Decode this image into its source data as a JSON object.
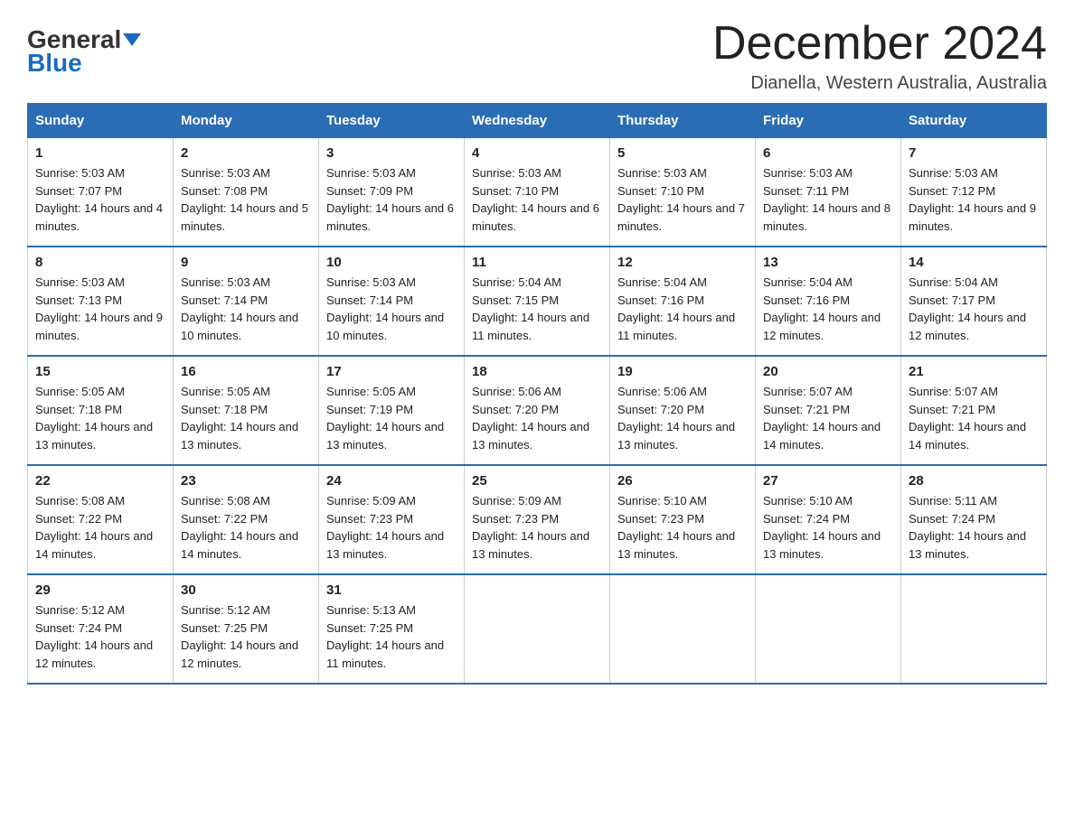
{
  "logo": {
    "general": "General",
    "blue": "Blue"
  },
  "header": {
    "month": "December 2024",
    "location": "Dianella, Western Australia, Australia"
  },
  "weekdays": [
    "Sunday",
    "Monday",
    "Tuesday",
    "Wednesday",
    "Thursday",
    "Friday",
    "Saturday"
  ],
  "weeks": [
    [
      {
        "day": "1",
        "sunrise": "5:03 AM",
        "sunset": "7:07 PM",
        "daylight": "14 hours and 4 minutes."
      },
      {
        "day": "2",
        "sunrise": "5:03 AM",
        "sunset": "7:08 PM",
        "daylight": "14 hours and 5 minutes."
      },
      {
        "day": "3",
        "sunrise": "5:03 AM",
        "sunset": "7:09 PM",
        "daylight": "14 hours and 6 minutes."
      },
      {
        "day": "4",
        "sunrise": "5:03 AM",
        "sunset": "7:10 PM",
        "daylight": "14 hours and 6 minutes."
      },
      {
        "day": "5",
        "sunrise": "5:03 AM",
        "sunset": "7:10 PM",
        "daylight": "14 hours and 7 minutes."
      },
      {
        "day": "6",
        "sunrise": "5:03 AM",
        "sunset": "7:11 PM",
        "daylight": "14 hours and 8 minutes."
      },
      {
        "day": "7",
        "sunrise": "5:03 AM",
        "sunset": "7:12 PM",
        "daylight": "14 hours and 9 minutes."
      }
    ],
    [
      {
        "day": "8",
        "sunrise": "5:03 AM",
        "sunset": "7:13 PM",
        "daylight": "14 hours and 9 minutes."
      },
      {
        "day": "9",
        "sunrise": "5:03 AM",
        "sunset": "7:14 PM",
        "daylight": "14 hours and 10 minutes."
      },
      {
        "day": "10",
        "sunrise": "5:03 AM",
        "sunset": "7:14 PM",
        "daylight": "14 hours and 10 minutes."
      },
      {
        "day": "11",
        "sunrise": "5:04 AM",
        "sunset": "7:15 PM",
        "daylight": "14 hours and 11 minutes."
      },
      {
        "day": "12",
        "sunrise": "5:04 AM",
        "sunset": "7:16 PM",
        "daylight": "14 hours and 11 minutes."
      },
      {
        "day": "13",
        "sunrise": "5:04 AM",
        "sunset": "7:16 PM",
        "daylight": "14 hours and 12 minutes."
      },
      {
        "day": "14",
        "sunrise": "5:04 AM",
        "sunset": "7:17 PM",
        "daylight": "14 hours and 12 minutes."
      }
    ],
    [
      {
        "day": "15",
        "sunrise": "5:05 AM",
        "sunset": "7:18 PM",
        "daylight": "14 hours and 13 minutes."
      },
      {
        "day": "16",
        "sunrise": "5:05 AM",
        "sunset": "7:18 PM",
        "daylight": "14 hours and 13 minutes."
      },
      {
        "day": "17",
        "sunrise": "5:05 AM",
        "sunset": "7:19 PM",
        "daylight": "14 hours and 13 minutes."
      },
      {
        "day": "18",
        "sunrise": "5:06 AM",
        "sunset": "7:20 PM",
        "daylight": "14 hours and 13 minutes."
      },
      {
        "day": "19",
        "sunrise": "5:06 AM",
        "sunset": "7:20 PM",
        "daylight": "14 hours and 13 minutes."
      },
      {
        "day": "20",
        "sunrise": "5:07 AM",
        "sunset": "7:21 PM",
        "daylight": "14 hours and 14 minutes."
      },
      {
        "day": "21",
        "sunrise": "5:07 AM",
        "sunset": "7:21 PM",
        "daylight": "14 hours and 14 minutes."
      }
    ],
    [
      {
        "day": "22",
        "sunrise": "5:08 AM",
        "sunset": "7:22 PM",
        "daylight": "14 hours and 14 minutes."
      },
      {
        "day": "23",
        "sunrise": "5:08 AM",
        "sunset": "7:22 PM",
        "daylight": "14 hours and 14 minutes."
      },
      {
        "day": "24",
        "sunrise": "5:09 AM",
        "sunset": "7:23 PM",
        "daylight": "14 hours and 13 minutes."
      },
      {
        "day": "25",
        "sunrise": "5:09 AM",
        "sunset": "7:23 PM",
        "daylight": "14 hours and 13 minutes."
      },
      {
        "day": "26",
        "sunrise": "5:10 AM",
        "sunset": "7:23 PM",
        "daylight": "14 hours and 13 minutes."
      },
      {
        "day": "27",
        "sunrise": "5:10 AM",
        "sunset": "7:24 PM",
        "daylight": "14 hours and 13 minutes."
      },
      {
        "day": "28",
        "sunrise": "5:11 AM",
        "sunset": "7:24 PM",
        "daylight": "14 hours and 13 minutes."
      }
    ],
    [
      {
        "day": "29",
        "sunrise": "5:12 AM",
        "sunset": "7:24 PM",
        "daylight": "14 hours and 12 minutes."
      },
      {
        "day": "30",
        "sunrise": "5:12 AM",
        "sunset": "7:25 PM",
        "daylight": "14 hours and 12 minutes."
      },
      {
        "day": "31",
        "sunrise": "5:13 AM",
        "sunset": "7:25 PM",
        "daylight": "14 hours and 11 minutes."
      },
      null,
      null,
      null,
      null
    ]
  ],
  "labels": {
    "sunrise": "Sunrise:",
    "sunset": "Sunset:",
    "daylight": "Daylight:"
  }
}
